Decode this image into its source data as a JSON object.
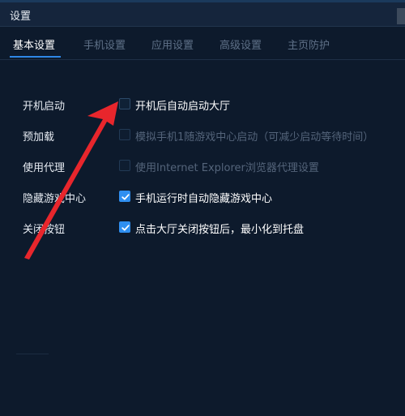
{
  "window": {
    "title": "设置"
  },
  "tabs": [
    {
      "label": "基本设置",
      "active": true
    },
    {
      "label": "手机设置",
      "active": false
    },
    {
      "label": "应用设置",
      "active": false
    },
    {
      "label": "高级设置",
      "active": false
    },
    {
      "label": "主页防护",
      "active": false
    }
  ],
  "settings": [
    {
      "label": "开机启动",
      "option": "开机后自动启动大厅",
      "checked": false,
      "enabled": true
    },
    {
      "label": "预加载",
      "option": "模拟手机1随游戏中心启动（可减少启动等待时间）",
      "checked": false,
      "enabled": false
    },
    {
      "label": "使用代理",
      "option": "使用Internet Explorer浏览器代理设置",
      "checked": false,
      "enabled": false
    },
    {
      "label": "隐藏游戏中心",
      "option": "手机运行时自动隐藏游戏中心",
      "checked": true,
      "enabled": true
    },
    {
      "label": "关闭按钮",
      "option": "点击大厅关闭按钮后，最小化到托盘",
      "checked": true,
      "enabled": true
    }
  ],
  "colors": {
    "background": "#0d1a2c",
    "accent": "#2f8ff0",
    "annotation_arrow": "#e8262c"
  },
  "icons": {
    "checkmark": "check-icon",
    "annotation": "red-arrow-annotation"
  }
}
